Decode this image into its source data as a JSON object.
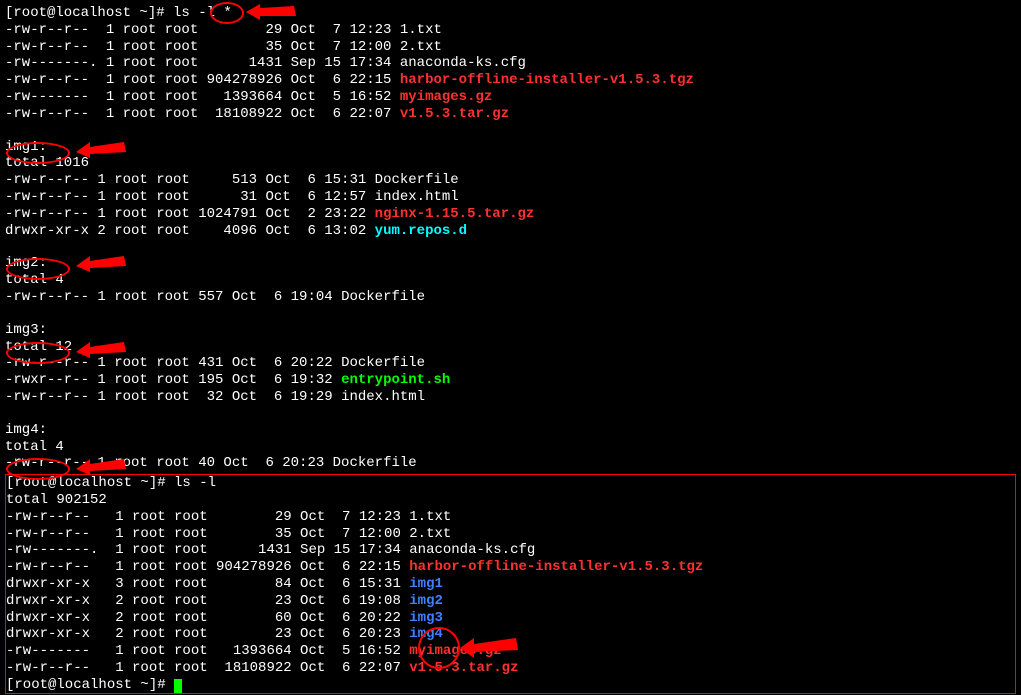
{
  "prompt1": "[root@localhost ~]# ls -l *",
  "top_files": [
    {
      "perm": "-rw-r--r--",
      "links": "1",
      "owner": "root",
      "group": "root",
      "size": "       29",
      "date": "Oct  7 12:23",
      "name": "1.txt",
      "cls": ""
    },
    {
      "perm": "-rw-r--r--",
      "links": "1",
      "owner": "root",
      "group": "root",
      "size": "       35",
      "date": "Oct  7 12:00",
      "name": "2.txt",
      "cls": ""
    },
    {
      "perm": "-rw-------.",
      "links": "1",
      "owner": "root",
      "group": "root",
      "size": "     1431",
      "date": "Sep 15 17:34",
      "name": "anaconda-ks.cfg",
      "cls": ""
    },
    {
      "perm": "-rw-r--r--",
      "links": "1",
      "owner": "root",
      "group": "root",
      "size": "904278926",
      "date": "Oct  6 22:15",
      "name": "harbor-offline-installer-v1.5.3.tgz",
      "cls": "red"
    },
    {
      "perm": "-rw-------",
      "links": "1",
      "owner": "root",
      "group": "root",
      "size": "  1393664",
      "date": "Oct  5 16:52",
      "name": "myimages.gz",
      "cls": "red"
    },
    {
      "perm": "-rw-r--r--",
      "links": "1",
      "owner": "root",
      "group": "root",
      "size": " 18108922",
      "date": "Oct  6 22:07",
      "name": "v1.5.3.tar.gz",
      "cls": "red"
    }
  ],
  "img1_header": "img1:",
  "img1_total": "total 1016",
  "img1_files": [
    {
      "perm": "-rw-r--r--",
      "links": "1",
      "owner": "root",
      "group": "root",
      "size": "    513",
      "date": "Oct  6 15:31",
      "name": "Dockerfile",
      "cls": ""
    },
    {
      "perm": "-rw-r--r--",
      "links": "1",
      "owner": "root",
      "group": "root",
      "size": "     31",
      "date": "Oct  6 12:57",
      "name": "index.html",
      "cls": ""
    },
    {
      "perm": "-rw-r--r--",
      "links": "1",
      "owner": "root",
      "group": "root",
      "size": "1024791",
      "date": "Oct  2 23:22",
      "name": "nginx-1.15.5.tar.gz",
      "cls": "red"
    },
    {
      "perm": "drwxr-xr-x",
      "links": "2",
      "owner": "root",
      "group": "root",
      "size": "   4096",
      "date": "Oct  6 13:02",
      "name": "yum.repos.d",
      "cls": "cyan"
    }
  ],
  "img2_header": "img2:",
  "img2_total": "total 4",
  "img2_files": [
    {
      "perm": "-rw-r--r--",
      "links": "1",
      "owner": "root",
      "group": "root",
      "size": "557",
      "date": "Oct  6 19:04",
      "name": "Dockerfile",
      "cls": ""
    }
  ],
  "img3_header": "img3:",
  "img3_total": "total 12",
  "img3_files": [
    {
      "perm": "-rw-r--r--",
      "links": "1",
      "owner": "root",
      "group": "root",
      "size": "431",
      "date": "Oct  6 20:22",
      "name": "Dockerfile",
      "cls": ""
    },
    {
      "perm": "-rwxr--r--",
      "links": "1",
      "owner": "root",
      "group": "root",
      "size": "195",
      "date": "Oct  6 19:32",
      "name": "entrypoint.sh",
      "cls": "green"
    },
    {
      "perm": "-rw-r--r--",
      "links": "1",
      "owner": "root",
      "group": "root",
      "size": " 32",
      "date": "Oct  6 19:29",
      "name": "index.html",
      "cls": ""
    }
  ],
  "img4_header": "img4:",
  "img4_total": "total 4",
  "img4_files": [
    {
      "perm": "-rw-r--r--",
      "links": "1",
      "owner": "root",
      "group": "root",
      "size": "40",
      "date": "Oct  6 20:23",
      "name": "Dockerfile",
      "cls": ""
    }
  ],
  "prompt2": "[root@localhost ~]# ls -l",
  "box_total": "total 902152",
  "box_files": [
    {
      "perm": "-rw-r--r--",
      "links": " 1",
      "owner": "root",
      "group": "root",
      "size": "       29",
      "date": "Oct  7 12:23",
      "name": "1.txt",
      "cls": ""
    },
    {
      "perm": "-rw-r--r--",
      "links": " 1",
      "owner": "root",
      "group": "root",
      "size": "       35",
      "date": "Oct  7 12:00",
      "name": "2.txt",
      "cls": ""
    },
    {
      "perm": "-rw-------.",
      "links": "1",
      "owner": "root",
      "group": "root",
      "size": "     1431",
      "date": "Sep 15 17:34",
      "name": "anaconda-ks.cfg",
      "cls": ""
    },
    {
      "perm": "-rw-r--r--",
      "links": " 1",
      "owner": "root",
      "group": "root",
      "size": "904278926",
      "date": "Oct  6 22:15",
      "name": "harbor-offline-installer-v1.5.3.tgz",
      "cls": "red"
    },
    {
      "perm": "drwxr-xr-x",
      "links": " 3",
      "owner": "root",
      "group": "root",
      "size": "       84",
      "date": "Oct  6 15:31",
      "name": "img1",
      "cls": "blue"
    },
    {
      "perm": "drwxr-xr-x",
      "links": " 2",
      "owner": "root",
      "group": "root",
      "size": "       23",
      "date": "Oct  6 19:08",
      "name": "img2",
      "cls": "blue"
    },
    {
      "perm": "drwxr-xr-x",
      "links": " 2",
      "owner": "root",
      "group": "root",
      "size": "       60",
      "date": "Oct  6 20:22",
      "name": "img3",
      "cls": "blue"
    },
    {
      "perm": "drwxr-xr-x",
      "links": " 2",
      "owner": "root",
      "group": "root",
      "size": "       23",
      "date": "Oct  6 20:23",
      "name": "img4",
      "cls": "blue"
    },
    {
      "perm": "-rw-------",
      "links": " 1",
      "owner": "root",
      "group": "root",
      "size": "  1393664",
      "date": "Oct  5 16:52",
      "name": "myimages.gz",
      "cls": "red"
    },
    {
      "perm": "-rw-r--r--",
      "links": " 1",
      "owner": "root",
      "group": "root",
      "size": " 18108922",
      "date": "Oct  6 22:07",
      "name": "v1.5.3.tar.gz",
      "cls": "red"
    }
  ],
  "prompt3": "[root@localhost ~]# "
}
